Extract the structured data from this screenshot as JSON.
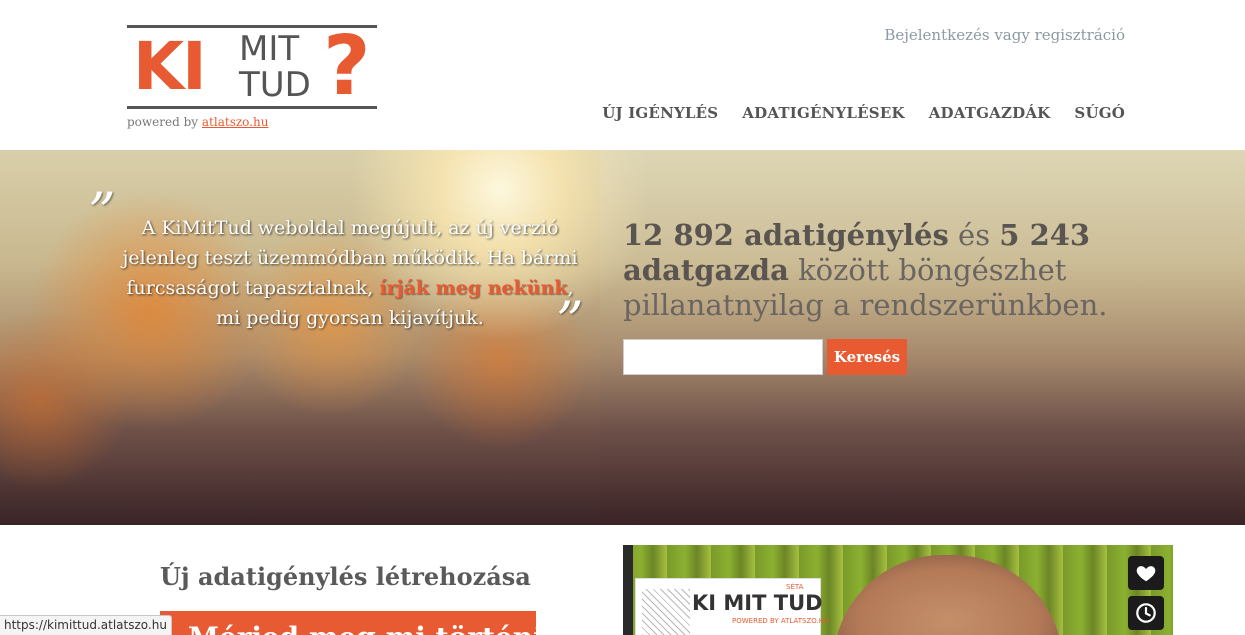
{
  "brand": {
    "logo_ki": "KI",
    "logo_mit": "MIT",
    "logo_tud": "TUD",
    "logo_q": "?",
    "powered_prefix": "powered by",
    "powered_link": "atlatszo.hu",
    "accent_color": "#e85a32"
  },
  "header": {
    "login_link": "Bejelentkezés vagy regisztráció"
  },
  "nav": {
    "items": [
      "ÚJ IGÉNYLÉS",
      "ADATIGÉNYLÉSEK",
      "ADATGAZDÁK",
      "SÚGÓ"
    ]
  },
  "hero": {
    "quote_open": "”",
    "quote_close": "”",
    "quote_part1": "A KiMitTud weboldal megújult, az új verzió jelenleg teszt üzemmódban működik. Ha bármi furcsaságot tapasztalnak, ",
    "quote_highlight": "írják meg nekünk",
    "quote_part2": ", mi pedig gyorsan kijavítjuk.",
    "stats_count_requests": "12 892 adatigénylés",
    "stats_and": " és ",
    "stats_count_holders": "5 243 adatgazda",
    "stats_rest": " között böngészhet pillanatnyilag a rendszerünkben.",
    "search_placeholder": "",
    "search_button": "Keresés"
  },
  "main": {
    "new_request_title": "Új adatigénylés létrehozása",
    "orange_box_text": "Mérjed meg mi történik"
  },
  "video": {
    "card_title": "KI MIT TUD",
    "card_small": "SÉTA",
    "card_powered": "POWERED BY ATLATSZO.HU",
    "like_icon": "heart-icon",
    "later_icon": "clock-icon"
  },
  "status_bar": {
    "url": "https://kimittud.atlatszo.hu"
  }
}
